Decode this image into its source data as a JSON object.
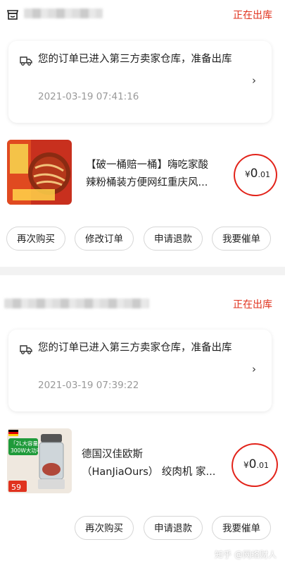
{
  "orders": [
    {
      "status": "正在出库",
      "notice_text": "您的订单已进入第三方卖家仓库，准备出库",
      "notice_time": "2021-03-19 07:41:16",
      "product_title_line1": "【破一桶赔一桶】嗨吃家酸",
      "product_title_line2": "辣粉桶装方便网红重庆风...",
      "price_currency": "¥",
      "price_int": "0",
      "price_dec": ".01",
      "buttons": [
        "再次购买",
        "修改订单",
        "申请退款",
        "我要催单"
      ]
    },
    {
      "status": "正在出库",
      "notice_text": "您的订单已进入第三方卖家仓库，准备出库",
      "notice_time": "2021-03-19 07:39:22",
      "product_title_line1": "德国汉佳欧斯",
      "product_title_line2": "（HanJiaOurs） 绞肉机 家...",
      "thumb_badge_line1": "「2L大容量」",
      "thumb_badge_line2": "300W大功率",
      "thumb_price": "59",
      "price_currency": "¥",
      "price_int": "0",
      "price_dec": ".01",
      "buttons": [
        "再次购买",
        "申请退款",
        "我要催单"
      ]
    }
  ],
  "watermark": "知乎 @网络财人",
  "colors": {
    "accent": "#e0321e",
    "annotation_circle": "#e2231a"
  }
}
